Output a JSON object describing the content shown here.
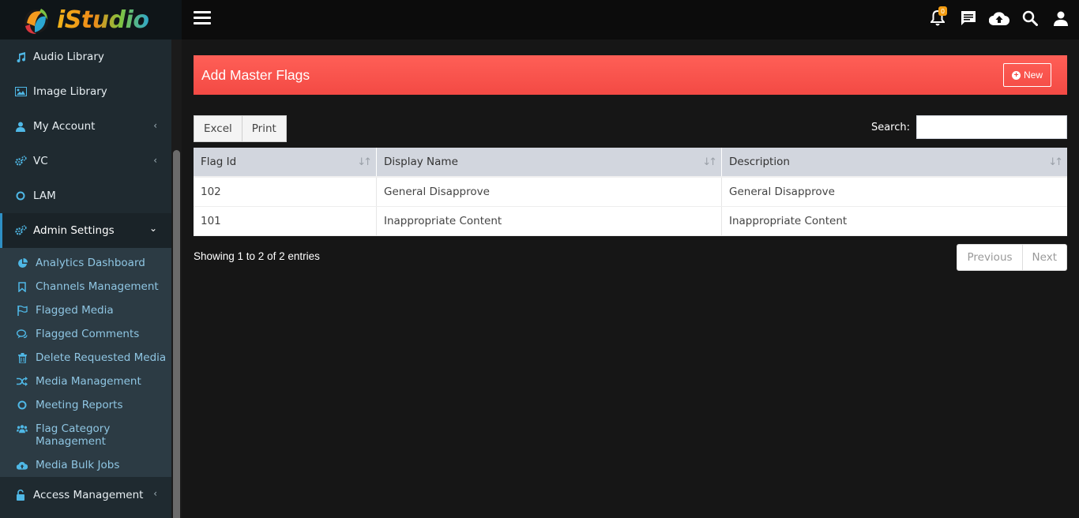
{
  "brand": {
    "logo_text": "iStudio"
  },
  "sidebar": {
    "items": [
      {
        "label": "Audio Library",
        "icon": "music-icon"
      },
      {
        "label": "Image Library",
        "icon": "image-icon"
      },
      {
        "label": "My Account",
        "icon": "user-icon",
        "has_chevron": true
      },
      {
        "label": "VC",
        "icon": "cogs-icon",
        "has_chevron": true
      },
      {
        "label": "LAM",
        "icon": "circle-icon"
      },
      {
        "label": "Admin Settings",
        "icon": "cogs-icon",
        "expanded": true
      }
    ],
    "submenu": [
      {
        "label": "Analytics Dashboard",
        "icon": "pie-chart-icon"
      },
      {
        "label": "Channels Management",
        "icon": "bookmark-icon"
      },
      {
        "label": "Flagged Media",
        "icon": "flag-icon"
      },
      {
        "label": "Flagged Comments",
        "icon": "comments-icon"
      },
      {
        "label": "Delete Requested Media",
        "icon": "trash-icon"
      },
      {
        "label": "Media Management",
        "icon": "random-icon"
      },
      {
        "label": "Meeting Reports",
        "icon": "circle-icon"
      },
      {
        "label": "Flag Category Management",
        "icon": "users-icon"
      },
      {
        "label": "Media Bulk Jobs",
        "icon": "cloud-upload-icon"
      }
    ],
    "footer_item": {
      "label": "Access Management",
      "icon": "unlock-icon"
    }
  },
  "topbar": {
    "notification_count": "0"
  },
  "page": {
    "title": "Add Master Flags",
    "new_button": "New",
    "export_buttons": [
      "Excel",
      "Print"
    ],
    "search_label": "Search:",
    "search_value": "",
    "columns": [
      "Flag Id",
      "Display Name",
      "Description"
    ],
    "rows": [
      [
        "102",
        "General Disapprove",
        "General Disapprove"
      ],
      [
        "101",
        "Inappropriate Content",
        "Inappropriate Content"
      ]
    ],
    "info": "Showing 1 to 2 of 2 entries",
    "pagination": {
      "previous": "Previous",
      "next": "Next"
    }
  },
  "colors": {
    "header_red": "#f34a44",
    "sidebar_bg": "#1f2a30",
    "submenu_bg": "#2c3b44",
    "accent_blue": "#4fb8e6"
  }
}
